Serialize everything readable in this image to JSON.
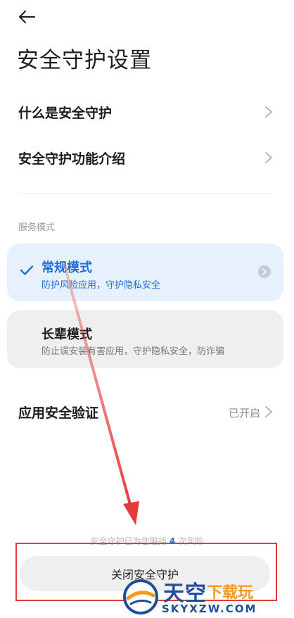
{
  "header": {
    "title": "安全守护设置"
  },
  "links": [
    {
      "label": "什么是安全守护"
    },
    {
      "label": "安全守护功能介绍"
    }
  ],
  "service_mode": {
    "section_label": "服务模式",
    "modes": [
      {
        "title": "常规模式",
        "subtitle": "防护风险应用，守护隐私安全",
        "selected": true
      },
      {
        "title": "长辈模式",
        "subtitle": "防止误安装有害应用，守护隐私安全，防诈骗",
        "selected": false
      }
    ]
  },
  "app_verify": {
    "label": "应用安全验证",
    "status": "已开启"
  },
  "footer": {
    "blocked_prefix": "安全守护已为您阻挡",
    "blocked_count": "4",
    "blocked_suffix": "次风险",
    "close_button": "关闭安全守护"
  },
  "watermark": {
    "main": "天空",
    "accent": "下载玩",
    "sub": "SKYXZW.COM"
  },
  "colors": {
    "accent": "#1f6fd8",
    "annotation": "#e53b3b",
    "selected_card": "#e6f1fd"
  }
}
